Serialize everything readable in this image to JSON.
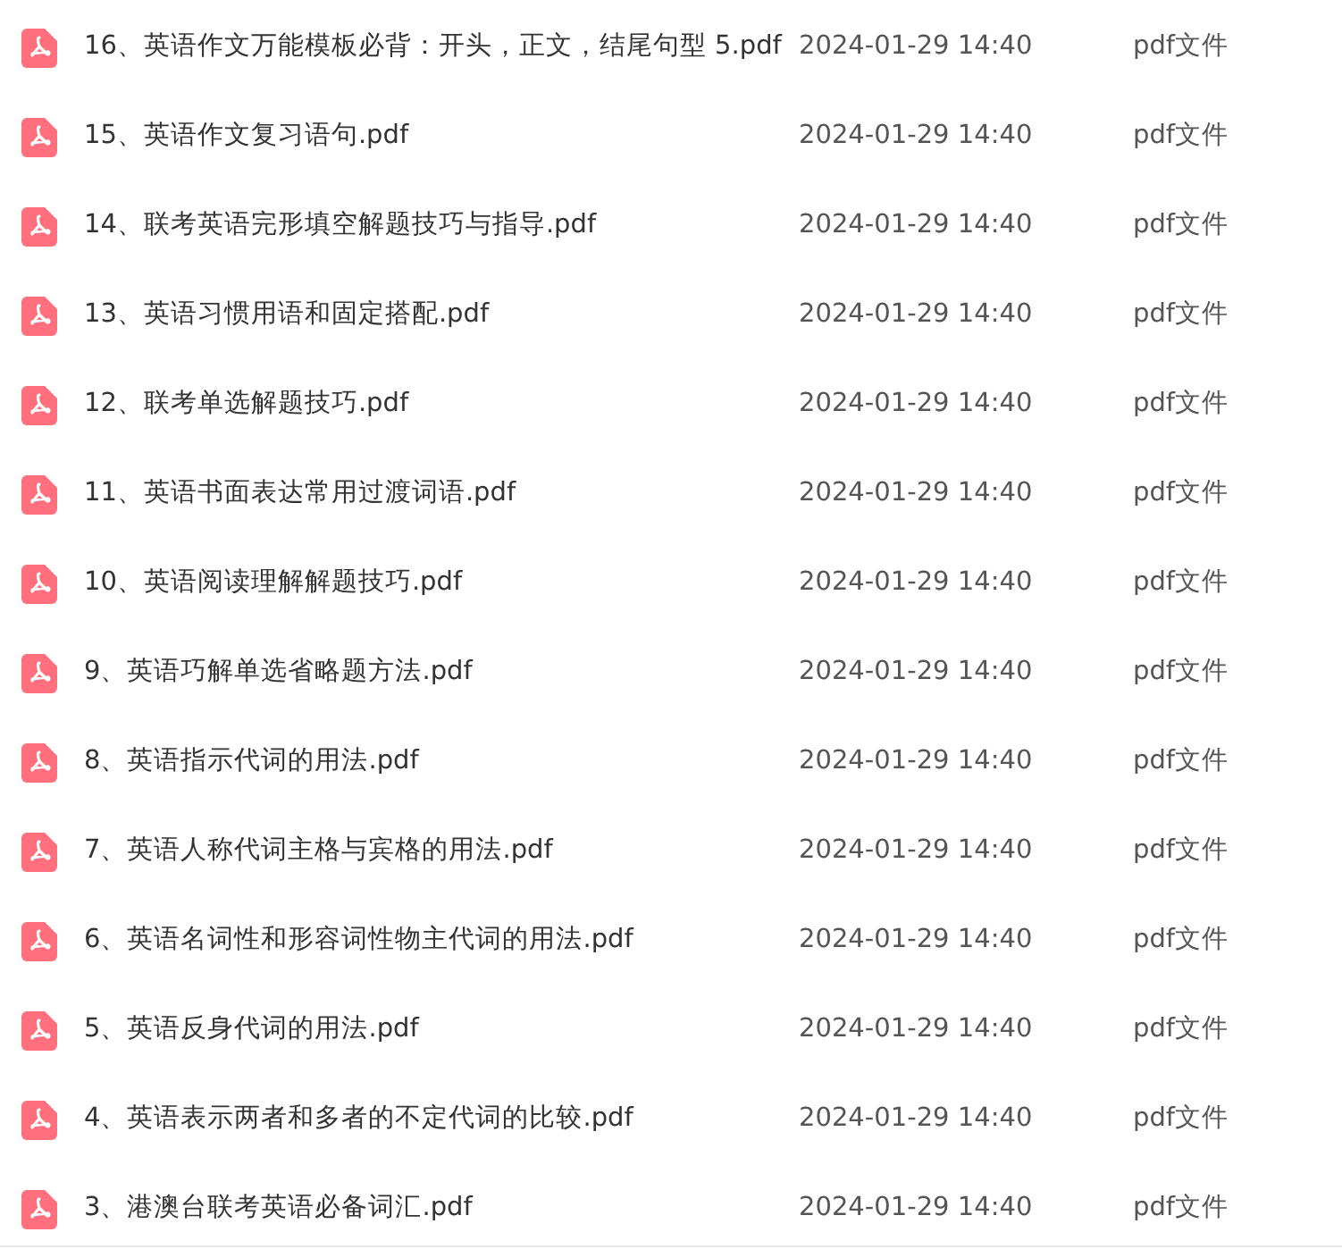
{
  "files": [
    {
      "name": "16、英语作文万能模板必背：开头，正文，结尾句型 5.pdf",
      "date": "2024-01-29 14:40",
      "type": "pdf文件"
    },
    {
      "name": "15、英语作文复习语句.pdf",
      "date": "2024-01-29 14:40",
      "type": "pdf文件"
    },
    {
      "name": "14、联考英语完形填空解题技巧与指导.pdf",
      "date": "2024-01-29 14:40",
      "type": "pdf文件"
    },
    {
      "name": "13、英语习惯用语和固定搭配.pdf",
      "date": "2024-01-29 14:40",
      "type": "pdf文件"
    },
    {
      "name": "12、联考单选解题技巧.pdf",
      "date": "2024-01-29 14:40",
      "type": "pdf文件"
    },
    {
      "name": "11、英语书面表达常用过渡词语.pdf",
      "date": "2024-01-29 14:40",
      "type": "pdf文件"
    },
    {
      "name": "10、英语阅读理解解题技巧.pdf",
      "date": "2024-01-29 14:40",
      "type": "pdf文件"
    },
    {
      "name": "9、英语巧解单选省略题方法.pdf",
      "date": "2024-01-29 14:40",
      "type": "pdf文件"
    },
    {
      "name": "8、英语指示代词的用法.pdf",
      "date": "2024-01-29 14:40",
      "type": "pdf文件"
    },
    {
      "name": "7、英语人称代词主格与宾格的用法.pdf",
      "date": "2024-01-29 14:40",
      "type": "pdf文件"
    },
    {
      "name": "6、英语名词性和形容词性物主代词的用法.pdf",
      "date": "2024-01-29 14:40",
      "type": "pdf文件"
    },
    {
      "name": "5、英语反身代词的用法.pdf",
      "date": "2024-01-29 14:40",
      "type": "pdf文件"
    },
    {
      "name": "4、英语表示两者和多者的不定代词的比较.pdf",
      "date": "2024-01-29 14:40",
      "type": "pdf文件"
    },
    {
      "name": "3、港澳台联考英语必备词汇.pdf",
      "date": "2024-01-29 14:40",
      "type": "pdf文件"
    }
  ]
}
